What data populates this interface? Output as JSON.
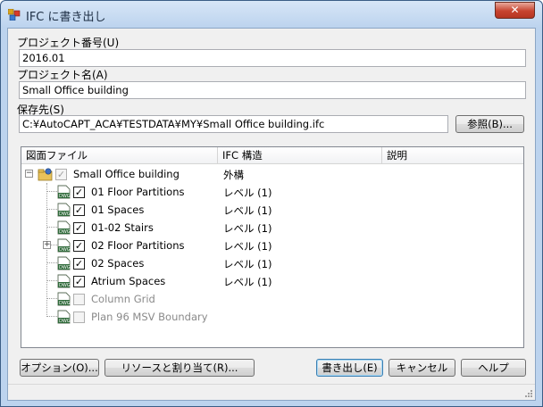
{
  "window": {
    "title": "IFC に書き出し",
    "close_label": "✕"
  },
  "form": {
    "project_number_label": "プロジェクト番号(U)",
    "project_number_value": "2016.01",
    "project_name_label": "プロジェクト名(A)",
    "project_name_value": "Small Office building",
    "save_to_label": "保存先(S)",
    "save_to_value": "C:¥AutoCAPT_ACA¥TESTDATA¥MY¥Small Office building.ifc",
    "browse_label": "参照(B)..."
  },
  "table": {
    "columns": [
      "図面ファイル",
      "IFC 構造",
      "説明"
    ],
    "root": {
      "name": "Small Office building",
      "structure": "外構"
    },
    "rows": [
      {
        "name": "01 Floor Partitions",
        "structure": "レベル (1)",
        "checked": true,
        "enabled": true,
        "expandable": false
      },
      {
        "name": "01 Spaces",
        "structure": "レベル (1)",
        "checked": true,
        "enabled": true,
        "expandable": false
      },
      {
        "name": "01-02 Stairs",
        "structure": "レベル (1)",
        "checked": true,
        "enabled": true,
        "expandable": false
      },
      {
        "name": "02 Floor Partitions",
        "structure": "レベル (1)",
        "checked": true,
        "enabled": true,
        "expandable": true
      },
      {
        "name": "02 Spaces",
        "structure": "レベル (1)",
        "checked": true,
        "enabled": true,
        "expandable": false
      },
      {
        "name": "Atrium Spaces",
        "structure": "レベル (1)",
        "checked": true,
        "enabled": true,
        "expandable": false
      },
      {
        "name": "Column Grid",
        "structure": "",
        "checked": false,
        "enabled": false,
        "expandable": false
      },
      {
        "name": "Plan 96 MSV Boundary",
        "structure": "",
        "checked": false,
        "enabled": false,
        "expandable": false
      }
    ]
  },
  "buttons": {
    "options": "オプション(O)...",
    "resources": "リソースと割り当て(R)...",
    "export": "書き出し(E)",
    "cancel": "キャンセル",
    "help": "ヘルプ"
  },
  "icons": {
    "app": "app-icon",
    "project": "project-folder-icon",
    "drawing": "dwg-file-icon",
    "expand": "plus-icon",
    "collapse": "minus-icon",
    "grip": "resize-grip-icon"
  },
  "colors": {
    "titlebar": "#bcd3ee",
    "close": "#c7432f",
    "client_bg": "#f0f0f0",
    "disabled_text": "#8a8a8a"
  }
}
